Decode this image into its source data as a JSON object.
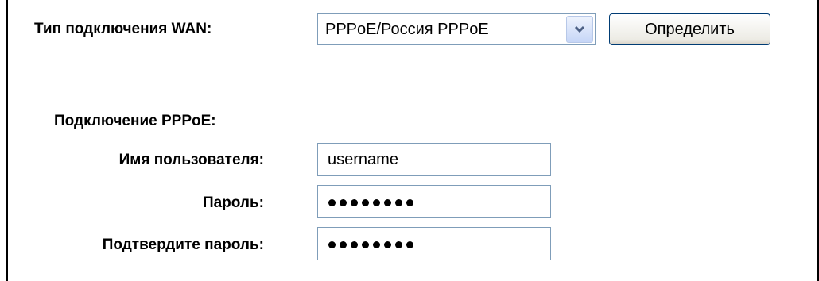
{
  "wan": {
    "connection_type_label": "Тип подключения WAN:",
    "connection_type_value": "PPPoE/Россия PPPoE",
    "detect_button_label": "Определить"
  },
  "pppoe": {
    "section_title": "Подключение PPPoE:",
    "username_label": "Имя пользователя:",
    "username_value": "username",
    "password_label": "Пароль:",
    "password_mask_length": 8,
    "confirm_password_label": "Подтвердите пароль:",
    "confirm_password_mask_length": 8
  }
}
